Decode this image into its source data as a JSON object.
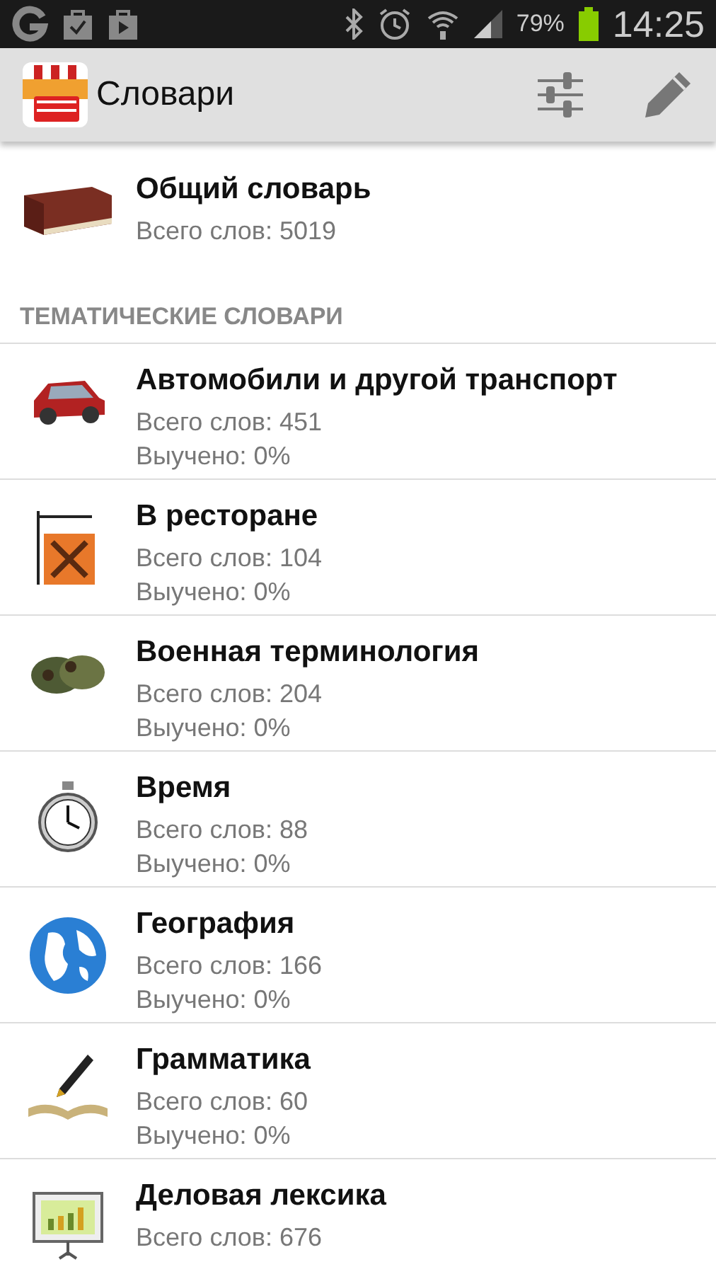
{
  "status_bar": {
    "battery": "79%",
    "time": "14:25"
  },
  "action_bar": {
    "title": "Словари"
  },
  "general": {
    "title": "Общий словарь",
    "count": "Всего слов: 5019"
  },
  "section": {
    "title": "ТЕМАТИЧЕСКИЕ СЛОВАРИ"
  },
  "dictionaries": [
    {
      "title": "Автомобили и другой транспорт",
      "count": "Всего слов: 451",
      "learned": "Выучено: 0%"
    },
    {
      "title": "В ресторане",
      "count": "Всего слов: 104",
      "learned": "Выучено: 0%"
    },
    {
      "title": "Военная терминология",
      "count": "Всего слов: 204",
      "learned": "Выучено: 0%"
    },
    {
      "title": "Время",
      "count": "Всего слов: 88",
      "learned": "Выучено: 0%"
    },
    {
      "title": "География",
      "count": "Всего слов: 166",
      "learned": "Выучено: 0%"
    },
    {
      "title": "Грамматика",
      "count": "Всего слов: 60",
      "learned": "Выучено: 0%"
    },
    {
      "title": "Деловая лексика",
      "count": "Всего слов: 676"
    }
  ]
}
